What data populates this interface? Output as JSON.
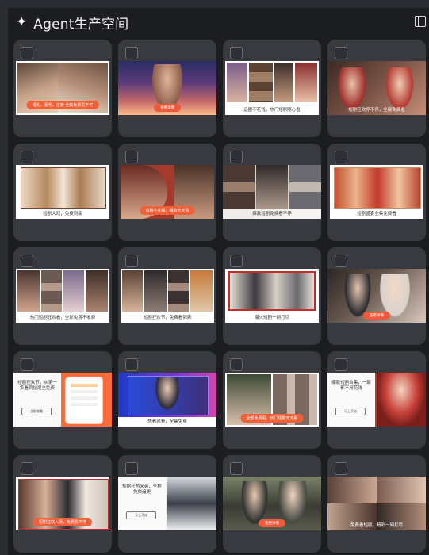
{
  "header": {
    "title": "Agent生产空间",
    "sparkle_icon": "sparkle-icon",
    "panel_icon": "panel-toggle-icon"
  },
  "cards": [
    {
      "caption": "",
      "pill": "婚礼，豪宅，逆袭 全集免费看不停"
    },
    {
      "caption": "",
      "pill": "查看详情"
    },
    {
      "caption": "追剧不花钱，热门短剧随心看",
      "pill": ""
    },
    {
      "caption": "短剧狂欢停不停，全部免费看",
      "pill": ""
    },
    {
      "caption": "短剧大戏，免费到底",
      "pill": ""
    },
    {
      "caption": "",
      "pill": "追剧不花钱，爆款天天看"
    },
    {
      "caption": "爆款短剧免费看不停",
      "pill": ""
    },
    {
      "caption": "短剧盛宴全集免费看",
      "pill": ""
    },
    {
      "caption": "热门短剧狂欢看，全部免费不收费",
      "pill": ""
    },
    {
      "caption": "短剧狂欢节，免费看到爽",
      "pill": ""
    },
    {
      "caption": "爆火短剧一网打尽",
      "pill": ""
    },
    {
      "caption": "",
      "pill": "查看详情"
    },
    {
      "caption": "",
      "pill": "",
      "ad_text": "短剧狂欢节，从第一集看到结尾全免费",
      "ad_button": "立即观看"
    },
    {
      "caption": "想看就看，全集免费",
      "pill": ""
    },
    {
      "caption": "",
      "pill": "全部免费看，热门短剧天天看"
    },
    {
      "caption": "",
      "pill": "",
      "ad_text": "爆款短剧合集，一部都不用花钱",
      "ad_button": "马上开始"
    },
    {
      "caption": "",
      "pill": "短剧狂欢入场，免费看不停"
    },
    {
      "caption": "",
      "pill": "",
      "ad_text": "短剧狂热来袭，全程免费追更",
      "ad_button": "马上开始"
    },
    {
      "caption": "",
      "pill": "查看详情"
    },
    {
      "caption": "免费看短剧，精彩一网打尽",
      "pill": ""
    }
  ],
  "colors": {
    "background": "#2b2c31",
    "card": "#393a40",
    "accent": "#f2603a"
  }
}
